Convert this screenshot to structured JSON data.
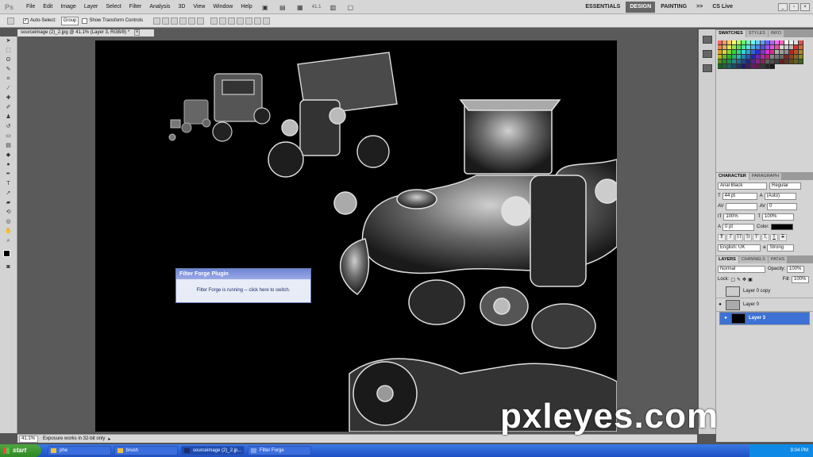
{
  "menubar": {
    "app_icon": "Ps",
    "menus": [
      "File",
      "Edit",
      "Image",
      "Layer",
      "Select",
      "Filter",
      "Analysis",
      "3D",
      "View",
      "Window",
      "Help"
    ],
    "zoom": "41.1",
    "workspaces": [
      "ESSENTIALS",
      "DESIGN",
      "PAINTING"
    ],
    "more": ">>",
    "cs_live": "CS Live"
  },
  "options": {
    "auto_select_label": "Auto-Select:",
    "auto_select_value": "Group",
    "show_transform_label": "Show Transform Controls"
  },
  "document": {
    "tab_title": "sourceimage (2)_2.jpg @ 41.1% (Layer 3, RGB/8) *"
  },
  "dialog": {
    "title": "Filter Forge Plugin",
    "message": "Filter Forge is running -- click here to switch."
  },
  "status": {
    "zoom": "41.1%",
    "text": "Exposure works in 32-bit only"
  },
  "swatches": {
    "tabs": [
      "SWATCHES",
      "STYLES",
      "INFO"
    ]
  },
  "character": {
    "tabs": [
      "CHARACTER",
      "PARAGRAPH"
    ],
    "font_family": "Arial Black",
    "font_style": "Regular",
    "size": "44 pt",
    "leading": "(Auto)",
    "kerning": "",
    "tracking": "0",
    "vscale": "100%",
    "hscale": "100%",
    "baseline": "0 pt",
    "color_label": "Color:",
    "format_buttons": [
      "T",
      "T",
      "TT",
      "Tr",
      "T'",
      "T,",
      "T",
      "T"
    ],
    "language": "English: UK",
    "aa_label": "a",
    "antialias": "Strong"
  },
  "layers": {
    "tabs": [
      "LAYERS",
      "CHANNELS",
      "PATHS"
    ],
    "blend_mode": "Normal",
    "opacity_label": "Opacity:",
    "opacity": "100%",
    "lock_label": "Lock:",
    "fill_label": "Fill:",
    "fill": "100%",
    "items": [
      {
        "name": "Layer 0 copy",
        "visible": "",
        "selected": false
      },
      {
        "name": "Layer 0",
        "visible": "●",
        "selected": false
      },
      {
        "name": "Layer 3",
        "visible": "●",
        "selected": true
      }
    ]
  },
  "taskbar": {
    "start": "start",
    "tasks": [
      {
        "label": "phe"
      },
      {
        "label": "brush"
      },
      {
        "label": "sourceimage (2)_2.jp..."
      },
      {
        "label": "Filter Forge"
      }
    ],
    "time": "9:04 PM"
  },
  "watermark": "pxleyes.com",
  "colors": {
    "accent": "#3d72d4",
    "taskbar": "#245edb",
    "start": "#3a9a30",
    "canvas": "#000000"
  }
}
